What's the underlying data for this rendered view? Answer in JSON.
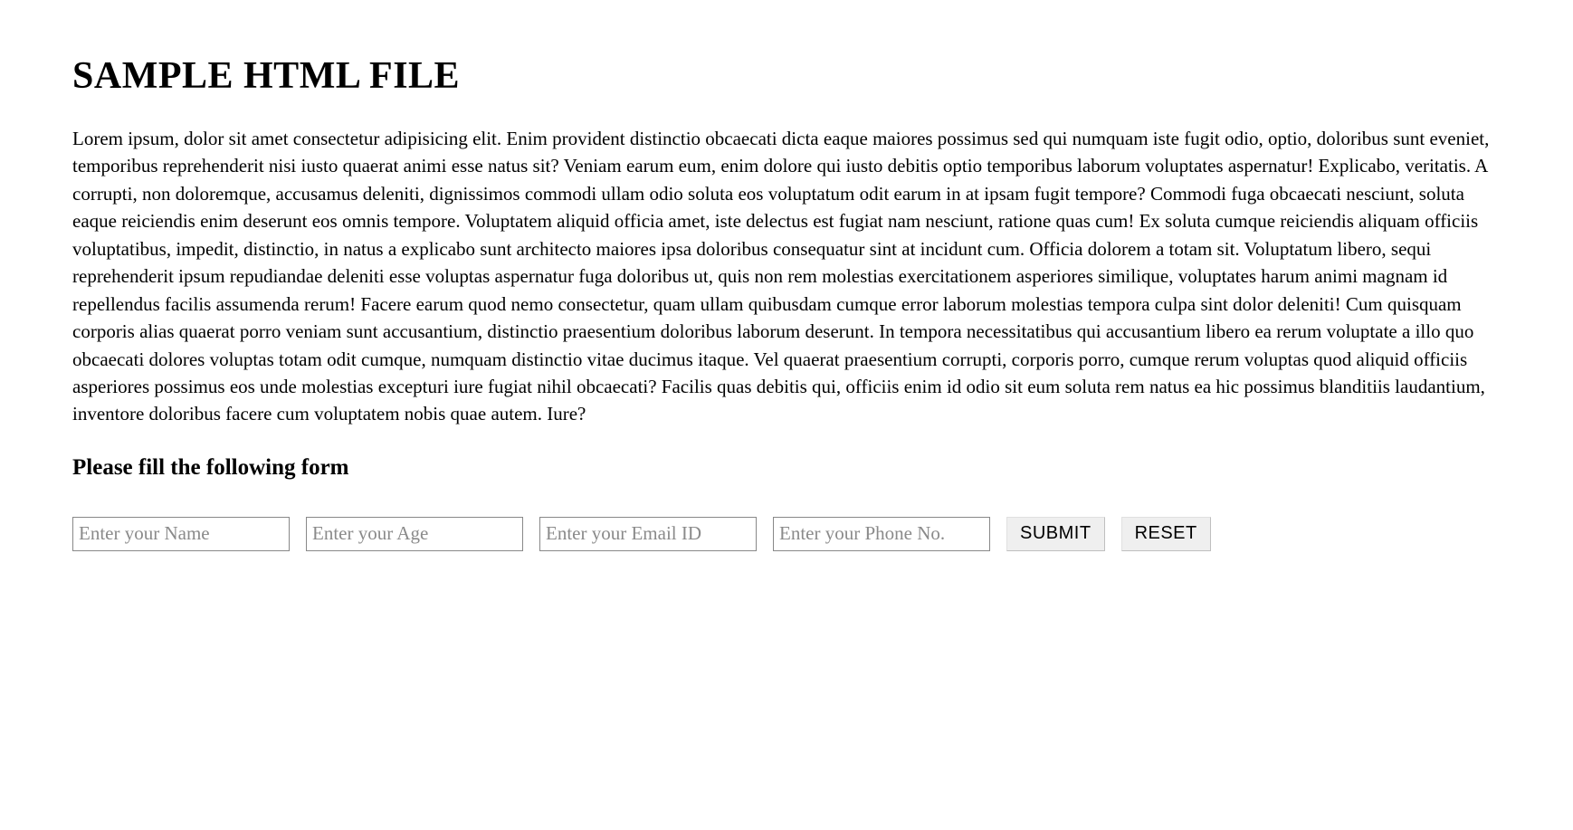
{
  "title": "SAMPLE HTML FILE",
  "paragraph": "Lorem ipsum, dolor sit amet consectetur adipisicing elit. Enim provident distinctio obcaecati dicta eaque maiores possimus sed qui numquam iste fugit odio, optio, doloribus sunt eveniet, temporibus reprehenderit nisi iusto quaerat animi esse natus sit? Veniam earum eum, enim dolore qui iusto debitis optio temporibus laborum voluptates aspernatur! Explicabo, veritatis. A corrupti, non doloremque, accusamus deleniti, dignissimos commodi ullam odio soluta eos voluptatum odit earum in at ipsam fugit tempore? Commodi fuga obcaecati nesciunt, soluta eaque reiciendis enim deserunt eos omnis tempore. Voluptatem aliquid officia amet, iste delectus est fugiat nam nesciunt, ratione quas cum! Ex soluta cumque reiciendis aliquam officiis voluptatibus, impedit, distinctio, in natus a explicabo sunt architecto maiores ipsa doloribus consequatur sint at incidunt cum. Officia dolorem a totam sit. Voluptatum libero, sequi reprehenderit ipsum repudiandae deleniti esse voluptas aspernatur fuga doloribus ut, quis non rem molestias exercitationem asperiores similique, voluptates harum animi magnam id repellendus facilis assumenda rerum! Facere earum quod nemo consectetur, quam ullam quibusdam cumque error laborum molestias tempora culpa sint dolor deleniti! Cum quisquam corporis alias quaerat porro veniam sunt accusantium, distinctio praesentium doloribus laborum deserunt. In tempora necessitatibus qui accusantium libero ea rerum voluptate a illo quo obcaecati dolores voluptas totam odit cumque, numquam distinctio vitae ducimus itaque. Vel quaerat praesentium corrupti, corporis porro, cumque rerum voluptas quod aliquid officiis asperiores possimus eos unde molestias excepturi iure fugiat nihil obcaecati? Facilis quas debitis qui, officiis enim id odio sit eum soluta rem natus ea hic possimus blanditiis laudantium, inventore doloribus facere cum voluptatem nobis quae autem. Iure?",
  "form": {
    "heading": "Please fill the following form",
    "name": {
      "placeholder": "Enter your Name",
      "value": ""
    },
    "age": {
      "placeholder": "Enter your Age",
      "value": ""
    },
    "email": {
      "placeholder": "Enter your Email ID",
      "value": ""
    },
    "phone": {
      "placeholder": "Enter your Phone No.",
      "value": ""
    },
    "submit_label": "SUBMIT",
    "reset_label": "RESET"
  }
}
